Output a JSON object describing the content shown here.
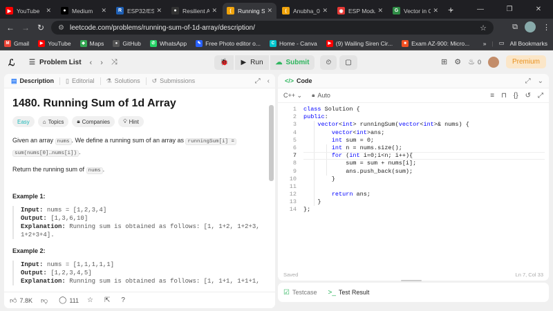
{
  "browser": {
    "tabs": [
      {
        "label": "YouTube",
        "icon": "youtube-icon",
        "color": "#ff0000",
        "glyph": "▶"
      },
      {
        "label": "Medium",
        "icon": "medium-icon",
        "color": "#000000",
        "glyph": "●"
      },
      {
        "label": "ESP32/ESP",
        "icon": "r-icon",
        "color": "#1e5fb4",
        "glyph": "R"
      },
      {
        "label": "Resilient A",
        "icon": "github-icon",
        "color": "#333333",
        "glyph": "●"
      },
      {
        "label": "Running S",
        "icon": "leetcode-icon",
        "color": "#f0a30a",
        "glyph": "⟨"
      },
      {
        "label": "Anubha_0",
        "icon": "leetcode-icon",
        "color": "#f0a30a",
        "glyph": "⟨"
      },
      {
        "label": "ESP Modu",
        "icon": "espressif-icon",
        "color": "#e53935",
        "glyph": "◉"
      },
      {
        "label": "Vector in C",
        "icon": "gfg-icon",
        "color": "#2f8d46",
        "glyph": "G"
      }
    ],
    "active_tab_index": 4,
    "url": "leetcode.com/problems/running-sum-of-1d-array/description/",
    "bookmarks": [
      {
        "label": "Gmail",
        "color": "#ea4335",
        "glyph": "M"
      },
      {
        "label": "YouTube",
        "color": "#ff0000",
        "glyph": "▶"
      },
      {
        "label": "Maps",
        "color": "#34a853",
        "glyph": "◆"
      },
      {
        "label": "GitHub",
        "color": "#555555",
        "glyph": "●"
      },
      {
        "label": "WhatsApp",
        "color": "#25d366",
        "glyph": "✆"
      },
      {
        "label": "Free Photo editor o...",
        "color": "#2962ff",
        "glyph": "✎"
      },
      {
        "label": "Home - Canva",
        "color": "#00c4cc",
        "glyph": "C"
      },
      {
        "label": "(9) Wailing Siren Cir...",
        "color": "#ff0000",
        "glyph": "▶"
      },
      {
        "label": "Exam AZ-900: Micro...",
        "color": "#f25022",
        "glyph": "■"
      }
    ],
    "all_bookmarks": "All Bookmarks"
  },
  "nav": {
    "problem_list": "Problem List",
    "run": "Run",
    "submit": "Submit",
    "points": "0",
    "premium": "Premium"
  },
  "left": {
    "tabs": [
      "Description",
      "Editorial",
      "Solutions",
      "Submissions"
    ],
    "title": "1480. Running Sum of 1d Array",
    "chips": [
      "Easy",
      "Topics",
      "Companies",
      "Hint"
    ],
    "para1_a": "Given an array ",
    "para1_code1": "nums",
    "para1_b": ". We define a running sum of an array as ",
    "para1_code2": "runningSum[i] =",
    "para1_code3": "sum(nums[0]…nums[i])",
    "para1_c": ".",
    "para2_a": "Return the running sum of ",
    "para2_code": "nums",
    "para2_b": ".",
    "example1": {
      "heading": "Example 1:",
      "input_label": "Input:",
      "input_value": "nums = [1,2,3,4]",
      "output_label": "Output:",
      "output_value": "[1,3,6,10]",
      "expl_label": "Explanation:",
      "expl_value": "Running sum is obtained as follows: [1, 1+2, 1+2+3,",
      "expl_value2": "1+2+3+4]."
    },
    "example2": {
      "heading": "Example 2:",
      "input_label": "Input:",
      "input_value": "nums = [1,1,1,1,1]",
      "output_label": "Output:",
      "output_value": "[1,2,3,4,5]",
      "expl_label": "Explanation:",
      "expl_value": "Running sum is obtained as follows: [1, 1+1, 1+1+1,"
    },
    "footer": {
      "likes": "7.8K",
      "comments": "111"
    }
  },
  "code": {
    "tab": "Code",
    "language": "C++",
    "auto": "Auto",
    "lines": [
      {
        "n": "1",
        "parts": [
          [
            "kw",
            "class "
          ],
          [
            "txt",
            "Solution {"
          ]
        ]
      },
      {
        "n": "2",
        "parts": [
          [
            "kw",
            "public"
          ],
          [
            "txt",
            ":"
          ]
        ]
      },
      {
        "n": "3",
        "parts": [
          [
            "txt",
            "    "
          ],
          [
            "kw",
            "vector"
          ],
          [
            "txt",
            "<"
          ],
          [
            "kw",
            "int"
          ],
          [
            "txt",
            "> runningSum("
          ],
          [
            "kw",
            "vector"
          ],
          [
            "txt",
            "<"
          ],
          [
            "kw",
            "int"
          ],
          [
            "txt",
            ">& nums) {"
          ]
        ]
      },
      {
        "n": "4",
        "parts": [
          [
            "txt",
            "        "
          ],
          [
            "kw",
            "vector"
          ],
          [
            "txt",
            "<"
          ],
          [
            "kw",
            "int"
          ],
          [
            "txt",
            ">ans;"
          ]
        ]
      },
      {
        "n": "5",
        "parts": [
          [
            "txt",
            "        "
          ],
          [
            "kw",
            "int"
          ],
          [
            "txt",
            " sum = 0;"
          ]
        ]
      },
      {
        "n": "6",
        "parts": [
          [
            "txt",
            "        "
          ],
          [
            "kw",
            "int"
          ],
          [
            "txt",
            " n = nums.size();"
          ]
        ]
      },
      {
        "n": "7",
        "parts": [
          [
            "txt",
            "        "
          ],
          [
            "kw",
            "for"
          ],
          [
            "txt",
            " ("
          ],
          [
            "kw",
            "int"
          ],
          [
            "txt",
            " i=0;i<n; i++){"
          ]
        ]
      },
      {
        "n": "8",
        "parts": [
          [
            "txt",
            "            sum = sum + nums[i];"
          ]
        ]
      },
      {
        "n": "9",
        "parts": [
          [
            "txt",
            "            ans.push_back(sum);"
          ]
        ]
      },
      {
        "n": "10",
        "parts": [
          [
            "txt",
            "        }"
          ]
        ]
      },
      {
        "n": "11",
        "parts": [
          [
            "txt",
            ""
          ]
        ]
      },
      {
        "n": "12",
        "parts": [
          [
            "txt",
            "        "
          ],
          [
            "kw",
            "return"
          ],
          [
            "txt",
            " ans;"
          ]
        ]
      },
      {
        "n": "13",
        "parts": [
          [
            "txt",
            "    }"
          ]
        ]
      },
      {
        "n": "14",
        "parts": [
          [
            "txt",
            "};"
          ]
        ]
      }
    ],
    "current_line": "7",
    "saved": "Saved",
    "cursor": "Ln 7, Col 33"
  },
  "bottom": {
    "testcase": "Testcase",
    "test_result": "Test Result"
  }
}
